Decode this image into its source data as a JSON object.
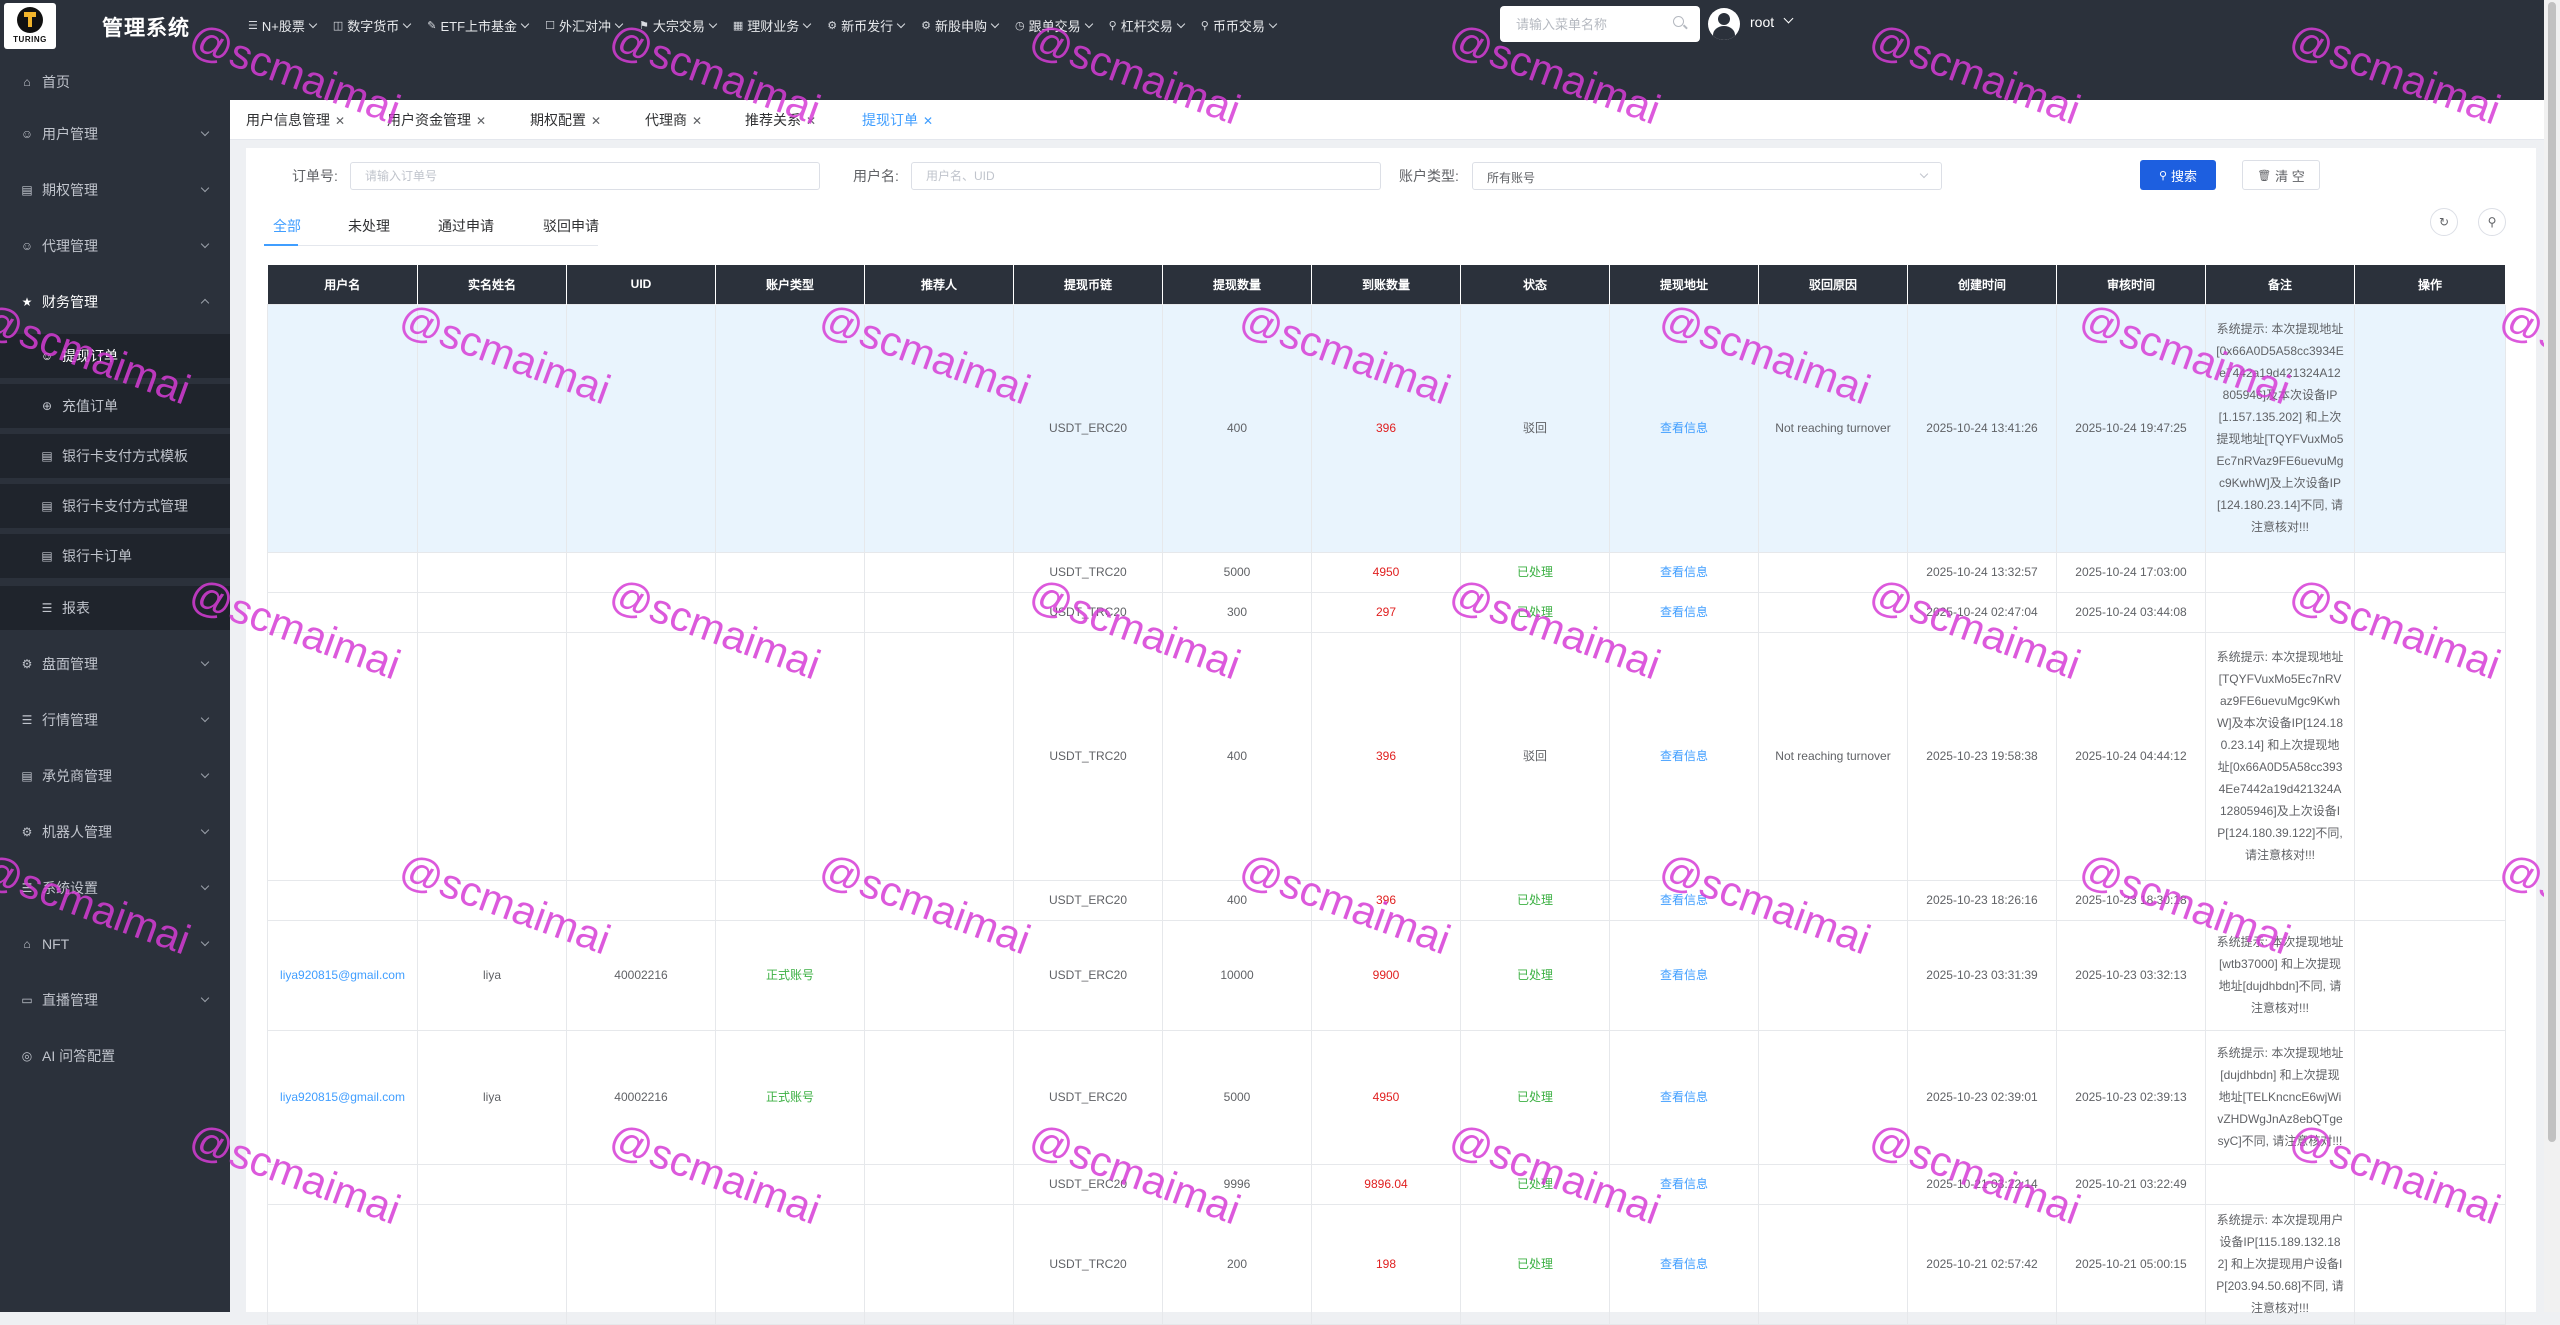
{
  "app": {
    "logo_text": "TURING",
    "title": "管理系统"
  },
  "topnav": [
    {
      "icon": "☰",
      "label": "N+股票"
    },
    {
      "icon": "◫",
      "label": "数字货币"
    },
    {
      "icon": "✎",
      "label": "ETF上市基金"
    },
    {
      "icon": "☐",
      "label": "外汇对冲"
    },
    {
      "icon": "⚑",
      "label": "大宗交易"
    },
    {
      "icon": "▦",
      "label": "理财业务"
    },
    {
      "icon": "⚙",
      "label": "新币发行"
    },
    {
      "icon": "⚙",
      "label": "新股申购"
    },
    {
      "icon": "◷",
      "label": "跟单交易"
    },
    {
      "icon": "⚲",
      "label": "杠杆交易"
    },
    {
      "icon": "⚲",
      "label": "币币交易"
    }
  ],
  "menu_search": {
    "placeholder": "请输入菜单名称"
  },
  "user": {
    "name": "root"
  },
  "sidebar": {
    "items": [
      {
        "icon": "⌂",
        "label": "首页"
      },
      {
        "icon": "☺",
        "label": "用户管理"
      },
      {
        "icon": "▤",
        "label": "期权管理"
      },
      {
        "icon": "☺",
        "label": "代理管理"
      },
      {
        "icon": "★",
        "label": "财务管理"
      },
      {
        "icon": "☰",
        "label": "报表"
      },
      {
        "icon": "⚙",
        "label": "盘面管理"
      },
      {
        "icon": "☰",
        "label": "行情管理"
      },
      {
        "icon": "▤",
        "label": "承兑商管理"
      },
      {
        "icon": "⚙",
        "label": "机器人管理"
      },
      {
        "icon": "☰",
        "label": "系统设置"
      },
      {
        "icon": "⌂",
        "label": "NFT"
      },
      {
        "icon": "▭",
        "label": "直播管理"
      },
      {
        "icon": "◎",
        "label": "AI 问答配置"
      }
    ],
    "sub_items": [
      {
        "icon": "☺",
        "label": "提现订单"
      },
      {
        "icon": "⊕",
        "label": "充值订单"
      },
      {
        "icon": "▤",
        "label": "银行卡支付方式模板"
      },
      {
        "icon": "▤",
        "label": "银行卡支付方式管理"
      },
      {
        "icon": "▤",
        "label": "银行卡订单"
      }
    ]
  },
  "tabs": [
    {
      "label": "用户信息管理"
    },
    {
      "label": "用户资金管理"
    },
    {
      "label": "期权配置"
    },
    {
      "label": "代理商"
    },
    {
      "label": "推荐关系"
    },
    {
      "label": "提现订单"
    }
  ],
  "filters": {
    "order_label": "订单号:",
    "order_placeholder": "请输入订单号",
    "user_label": "用户名:",
    "user_placeholder": "用户名、UID",
    "account_type_label": "账户类型:",
    "account_type_value": "所有账号",
    "search_label": "搜索",
    "clear_label": "清 空"
  },
  "status_tabs": [
    "全部",
    "未处理",
    "通过申请",
    "驳回申请"
  ],
  "table": {
    "columns": [
      "用户名",
      "实名姓名",
      "UID",
      "账户类型",
      "推荐人",
      "提现币链",
      "提现数量",
      "到账数量",
      "状态",
      "提现地址",
      "驳回原因",
      "创建时间",
      "审核时间",
      "备注",
      "操作"
    ],
    "link_text": "查看信息",
    "rows": [
      {
        "username": "",
        "realname": "",
        "uid": "",
        "account_type": "",
        "referrer": "",
        "chain": "USDT_ERC20",
        "amount": "400",
        "received": "396",
        "status": "驳回",
        "reject_reason": "Not reaching turnover",
        "created": "2025-10-24 13:41:26",
        "reviewed": "2025-10-24 19:47:25",
        "remark": "系统提示: 本次提现地址[0x66A0D5A58cc3934Ee7442a19d421324A12805946]及本次设备IP[1.157.135.202] 和上次提现地址[TQYFVuxMo5Ec7nRVaz9FE6uevuMgc9KwhW]及上次设备IP[124.180.23.14]不同, 请注意核对!!!"
      },
      {
        "username": "",
        "realname": "",
        "uid": "",
        "account_type": "",
        "referrer": "",
        "chain": "USDT_TRC20",
        "amount": "5000",
        "received": "4950",
        "status": "已处理",
        "reject_reason": "",
        "created": "2025-10-24 13:32:57",
        "reviewed": "2025-10-24 17:03:00",
        "remark": ""
      },
      {
        "username": "",
        "realname": "",
        "uid": "",
        "account_type": "",
        "referrer": "",
        "chain": "USDT_TRC20",
        "amount": "300",
        "received": "297",
        "status": "已处理",
        "reject_reason": "",
        "created": "2025-10-24 02:47:04",
        "reviewed": "2025-10-24 03:44:08",
        "remark": ""
      },
      {
        "username": "",
        "realname": "",
        "uid": "",
        "account_type": "",
        "referrer": "",
        "chain": "USDT_TRC20",
        "amount": "400",
        "received": "396",
        "status": "驳回",
        "reject_reason": "Not reaching turnover",
        "created": "2025-10-23 19:58:38",
        "reviewed": "2025-10-24 04:44:12",
        "remark": "系统提示: 本次提现地址[TQYFVuxMo5Ec7nRVaz9FE6uevuMgc9KwhW]及本次设备IP[124.180.23.14] 和上次提现地址[0x66A0D5A58cc3934Ee7442a19d421324A12805946]及上次设备IP[124.180.39.122]不同, 请注意核对!!!"
      },
      {
        "username": "",
        "realname": "",
        "uid": "",
        "account_type": "",
        "referrer": "",
        "chain": "USDT_ERC20",
        "amount": "400",
        "received": "396",
        "status": "已处理",
        "reject_reason": "",
        "created": "2025-10-23 18:26:16",
        "reviewed": "2025-10-23 18:30:18",
        "remark": ""
      },
      {
        "username": "liya920815@gmail.com",
        "realname": "liya",
        "uid": "40002216",
        "account_type": "正式账号",
        "referrer": "",
        "chain": "USDT_ERC20",
        "amount": "10000",
        "received": "9900",
        "status": "已处理",
        "reject_reason": "",
        "created": "2025-10-23 03:31:39",
        "reviewed": "2025-10-23 03:32:13",
        "remark": "系统提示: 本次提现地址[wtb37000] 和上次提现地址[dujdhbdn]不同, 请注意核对!!!"
      },
      {
        "username": "liya920815@gmail.com",
        "realname": "liya",
        "uid": "40002216",
        "account_type": "正式账号",
        "referrer": "",
        "chain": "USDT_ERC20",
        "amount": "5000",
        "received": "4950",
        "status": "已处理",
        "reject_reason": "",
        "created": "2025-10-23 02:39:01",
        "reviewed": "2025-10-23 02:39:13",
        "remark": "系统提示: 本次提现地址[dujdhbdn] 和上次提现地址[TELKncncE6wjWivZHDWgJnAz8ebQTgesyC]不同, 请注意核对!!!"
      },
      {
        "username": "",
        "realname": "",
        "uid": "",
        "account_type": "",
        "referrer": "",
        "chain": "USDT_ERC20",
        "amount": "9996",
        "received": "9896.04",
        "status": "已处理",
        "reject_reason": "",
        "created": "2025-10-21 03:22:14",
        "reviewed": "2025-10-21 03:22:49",
        "remark": ""
      },
      {
        "username": "",
        "realname": "",
        "uid": "",
        "account_type": "",
        "referrer": "",
        "chain": "USDT_TRC20",
        "amount": "200",
        "received": "198",
        "status": "已处理",
        "reject_reason": "",
        "created": "2025-10-21 02:57:42",
        "reviewed": "2025-10-21 05:00:15",
        "remark": "系统提示: 本次提现用户设备IP[115.189.132.182] 和上次提现用户设备IP[203.94.50.68]不同, 请注意核对!!!"
      }
    ]
  },
  "watermark_text": "@scmaimai",
  "colors": {
    "header_bg": "#2b313b",
    "accent": "#409eff",
    "primary_button": "#1d5fe0",
    "received_amount": "#e02020",
    "processed_status": "#3cb043",
    "watermark": "#d63cd6"
  }
}
